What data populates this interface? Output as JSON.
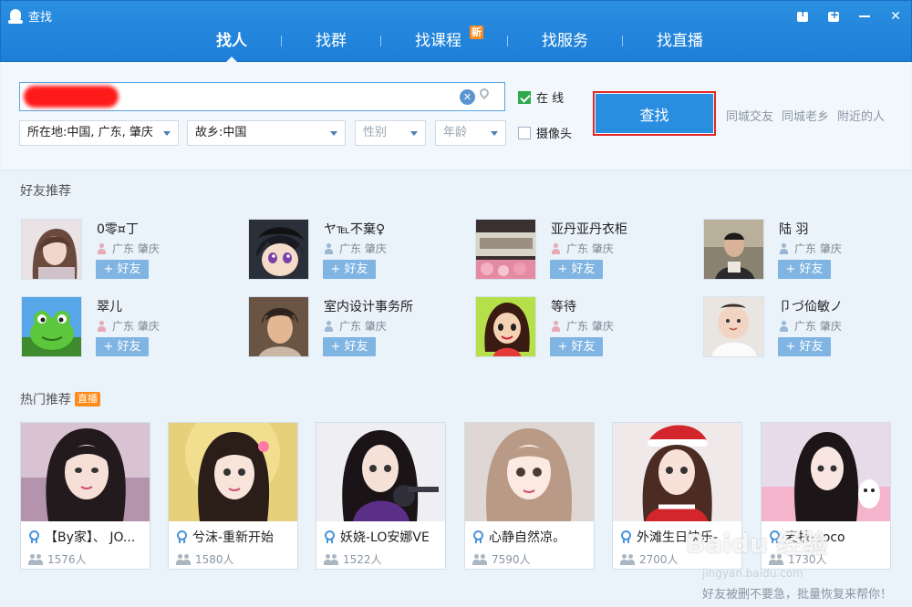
{
  "window": {
    "title": "查找",
    "controls": [
      "feedback-icon",
      "plus-icon",
      "minimize-icon",
      "close-icon"
    ]
  },
  "nav": {
    "tabs": [
      {
        "label": "找人",
        "active": true
      },
      {
        "label": "找群",
        "active": false
      },
      {
        "label": "找课程",
        "active": false,
        "badge": "新"
      },
      {
        "label": "找服务",
        "active": false
      },
      {
        "label": "找直播",
        "active": false
      }
    ]
  },
  "search": {
    "value": "",
    "placeholder": "",
    "clear_icon": "clear-icon",
    "location_icon": "location-pin-icon",
    "filters": {
      "location": "所在地:中国, 广东, 肇庆",
      "hometown": "故乡:中国",
      "gender": "性别",
      "age": "年龄"
    },
    "online_label": "在 线",
    "online_checked": true,
    "camera_label": "摄像头",
    "camera_checked": false,
    "button_label": "查找",
    "quick_links": [
      "同城交友",
      "同城老乡",
      "附近的人"
    ]
  },
  "friends": {
    "title": "好友推荐",
    "add_label": "+ 好友",
    "items": [
      {
        "name": "0零¤丁",
        "location": "广东  肇庆",
        "gender": "female"
      },
      {
        "name": "ヤ℡不棄♀",
        "location": "广东  肇庆",
        "gender": "male"
      },
      {
        "name": "亚丹亚丹衣柜",
        "location": "广东  肇庆",
        "gender": "female"
      },
      {
        "name": "陆 羽",
        "location": "广东  肇庆",
        "gender": "male"
      },
      {
        "name": "翠儿",
        "location": "广东  肇庆",
        "gender": "female"
      },
      {
        "name": "室内设计事务所",
        "location": "广东  肇庆",
        "gender": "male"
      },
      {
        "name": "等待",
        "location": "广东  肇庆",
        "gender": "female"
      },
      {
        "name": "卩づ佡敏ノ",
        "location": "广东  肇庆",
        "gender": "male"
      }
    ]
  },
  "hot": {
    "title": "热门推荐",
    "badge": "直播",
    "items": [
      {
        "title": "【By家】、 JO...",
        "count": "1576人"
      },
      {
        "title": "兮沫-重新开始",
        "count": "1580人"
      },
      {
        "title": "妖娆-LO安娜VE",
        "count": "1522人"
      },
      {
        "title": "心静自然凉。",
        "count": "7590人"
      },
      {
        "title": "外滩生日快乐-",
        "count": "2700人"
      },
      {
        "title": "麦扶-coco",
        "count": "1730人"
      }
    ]
  },
  "watermark": {
    "text": "Baidu 经验",
    "url": "jingyan.baidu.com"
  },
  "footer": {
    "text": "好友被删不要急，批量恢复来帮你！"
  }
}
